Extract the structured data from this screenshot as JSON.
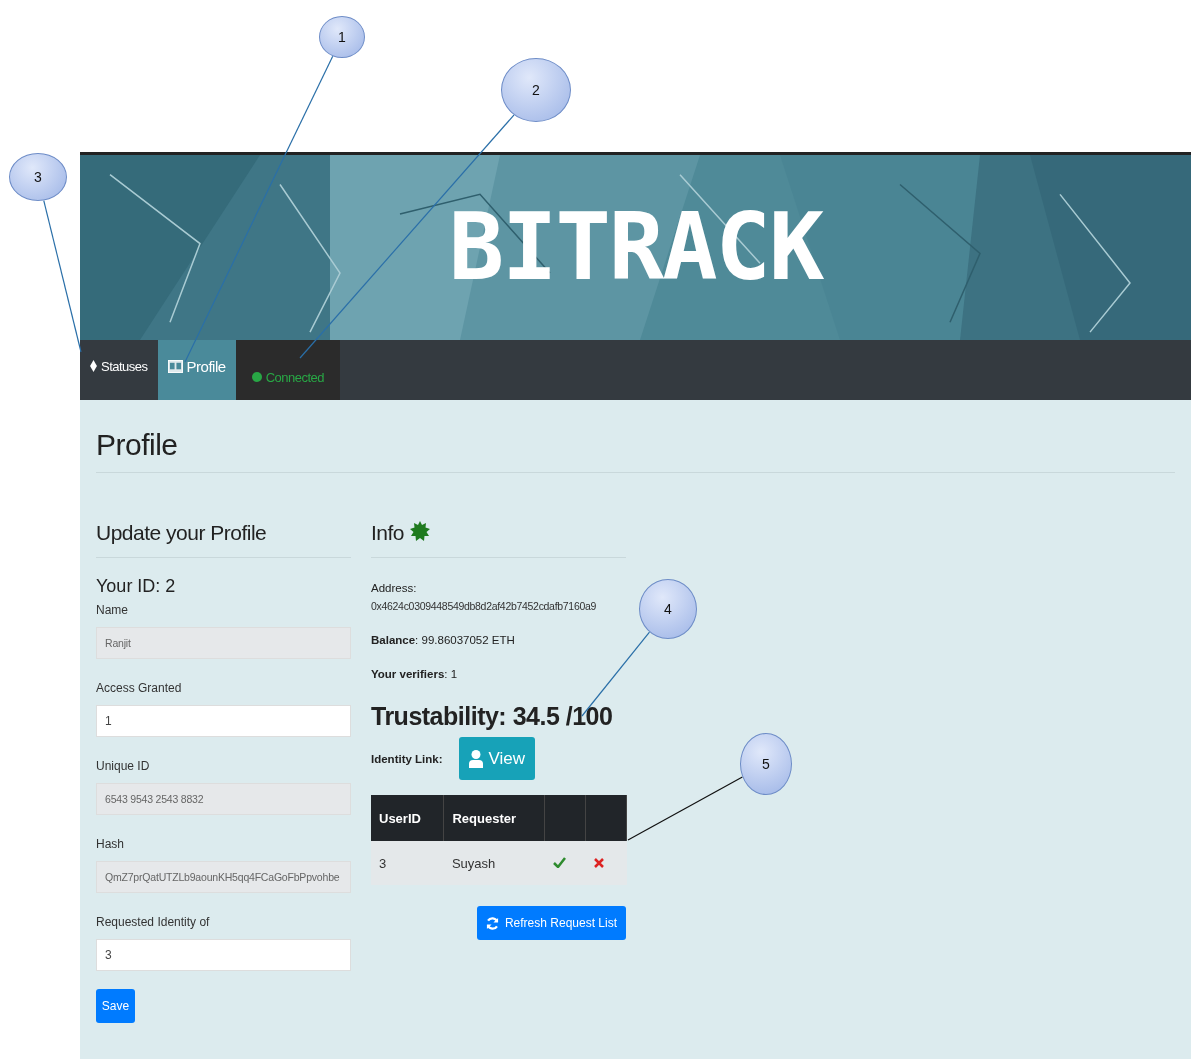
{
  "banner": {
    "title": "BITRACK"
  },
  "nav": [
    {
      "kind": "statuses",
      "label": "Statuses",
      "selected": false
    },
    {
      "kind": "profile",
      "label": "Profile",
      "selected": true
    },
    {
      "kind": "connected",
      "label": "Connected",
      "selected": false,
      "color": "#28a745"
    }
  ],
  "page_title": "Profile",
  "update_form": {
    "heading": "Update your Profile",
    "your_id": "Your ID: 2",
    "fields": [
      {
        "label": "Name",
        "value": "Ranjit",
        "disabled": true
      },
      {
        "label": "Access Granted",
        "value": "1",
        "disabled": false
      },
      {
        "label": "Unique ID",
        "value": "6543 9543 2543 8832",
        "disabled": true
      },
      {
        "label": "Hash",
        "value": "QmZ7prQatUTZLb9aounKH5qq4FCaGoFbPpvohbe",
        "disabled": true
      },
      {
        "label": "Requested Identity of",
        "value": "3",
        "disabled": false
      }
    ],
    "save_button": "Save"
  },
  "info": {
    "heading": "Info",
    "address_label": "Address:",
    "address": "0x4624c0309448549db8d2af42b7452cdafb7160a9",
    "balance_label": "Balance",
    "balance": ": 99.86037052 ETH",
    "verifiers_label": "Your verifiers",
    "verifiers": ": 1",
    "trustability": "Trustability: 34.5 /100",
    "identity_link_label": "Identity Link:",
    "view_button": "View",
    "table": {
      "columns": [
        "UserID",
        "Requester"
      ],
      "rows": [
        {
          "user_id": "3",
          "requester": "Suyash"
        }
      ]
    },
    "refresh_button": "Refresh Request List"
  },
  "callouts": [
    {
      "label": "1"
    },
    {
      "label": "2"
    },
    {
      "label": "3"
    },
    {
      "label": "4"
    },
    {
      "label": "5"
    }
  ]
}
